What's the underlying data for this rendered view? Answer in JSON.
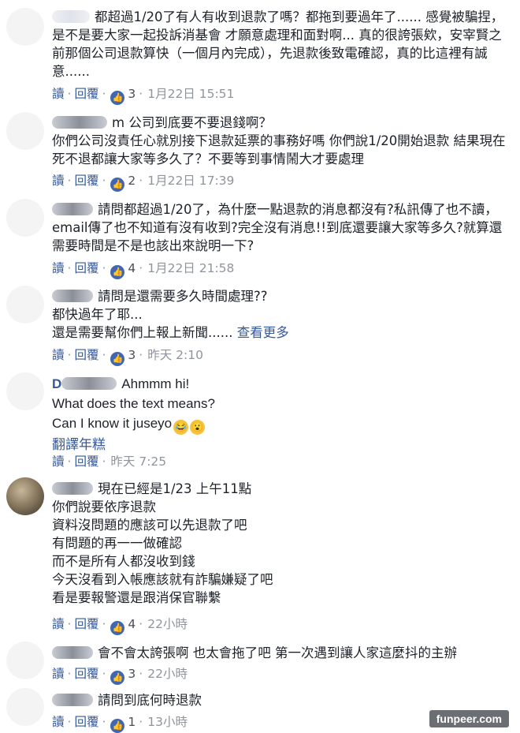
{
  "actions": {
    "read": "讀",
    "reply": "回覆",
    "dot": "·"
  },
  "comments": [
    {
      "text": "都超過1/20了有人有收到退款了嗎？都拖到要過年了...... 感覺被騙捏，是不是要大家一起投訴消基會 才願意處理和面對啊... 真的很誇張欸，安宰賢之前那個公司退款算快（一個月內完成），先退款後致電確認，真的比這裡有誠意......",
      "likes": "3",
      "time": "1月22日 15:51"
    },
    {
      "name_fragment": "m",
      "text": "公司到底要不要退錢啊？\n你們公司沒責任心就別接下退款延票的事務好嗎 你們說1/20開始退款 結果現在死不退都讓大家等多久了？不要等到事情鬧大才要處理",
      "likes": "2",
      "time": "1月22日 17:39"
    },
    {
      "text": "請問都超過1/20了，為什麼一點退款的消息都沒有?私訊傳了也不讀，email傳了也不知道有沒有收到?完全沒有消息!!到底還要讓大家等多久?就算還需要時間是不是也該出來說明一下?",
      "likes": "4",
      "time": "1月22日 21:58"
    },
    {
      "text": "請問是還需要多久時間處理??\n都快過年了耶...\n還是需要幫你們上報上新聞......",
      "see_more": "查看更多",
      "likes": "3",
      "time": "昨天 2:10"
    },
    {
      "name_fragment": "D",
      "text_lines": [
        "Ahmmm hi!",
        "What does the text means?",
        "Can I know it juseyo"
      ],
      "emojis": [
        "😂",
        "😮"
      ],
      "translate": "翻譯年糕",
      "likes": "",
      "time": "昨天 7:25"
    },
    {
      "text": "現在已經是1/23 上午11點\n你們說要依序退款\n資料沒問題的應該可以先退款了吧\n有問題的再一一做確認\n而不是所有人都沒收到錢\n今天沒看到入帳應該就有詐騙嫌疑了吧\n看是要報警還是跟消保官聯繫",
      "likes": "4",
      "time": "22小時"
    },
    {
      "text": "會不會太誇張啊 也太會拖了吧 第一次遇到讓人家這麼抖的主辦",
      "likes": "3",
      "time": "22小時"
    },
    {
      "text": "請問到底何時退款",
      "likes": "1",
      "time": "13小時"
    }
  ],
  "watermark": "funpeer.com"
}
